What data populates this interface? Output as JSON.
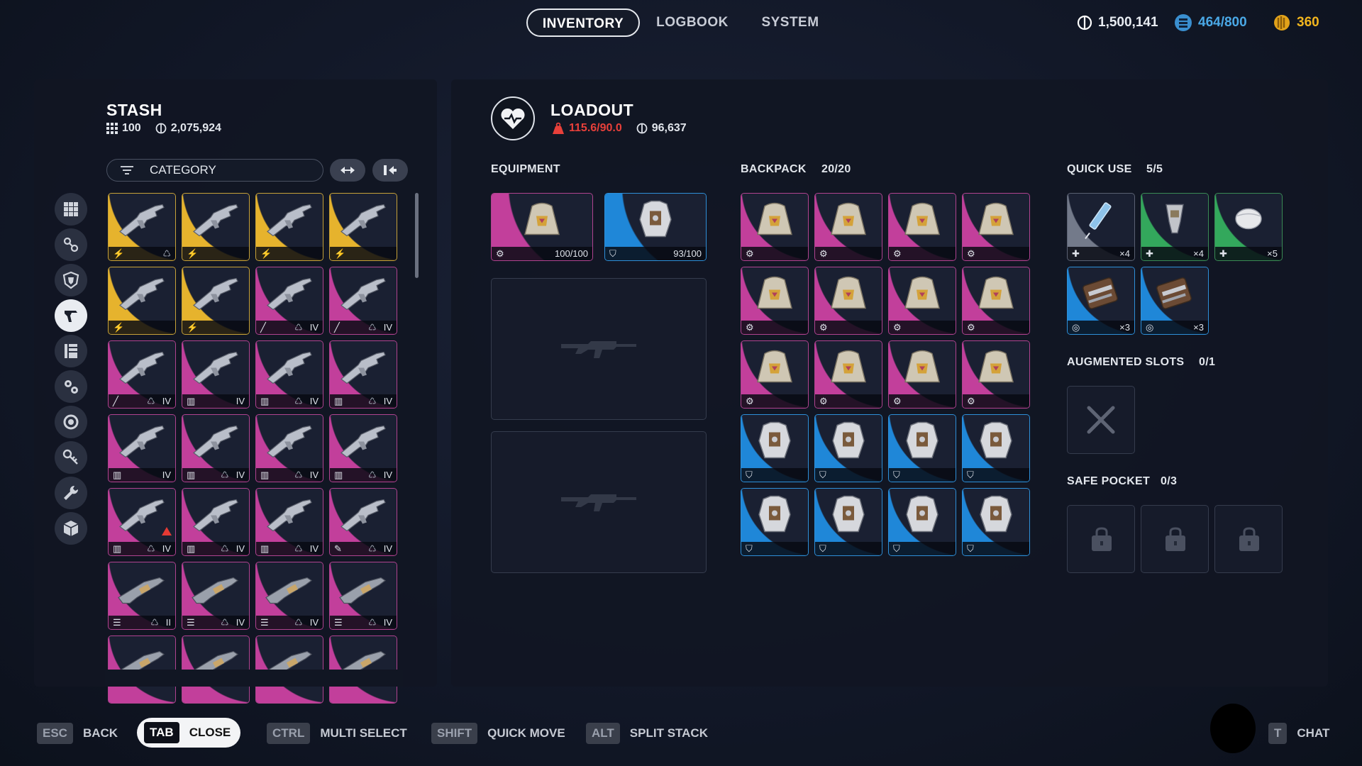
{
  "nav": {
    "tabs": [
      "INVENTORY",
      "LOGBOOK",
      "SYSTEM"
    ],
    "active": 0
  },
  "currency": {
    "coins": "1,500,141",
    "capacity": "464/800",
    "tokens": "360",
    "coins_color": "#ffffff",
    "capacity_color": "#4aa8e6",
    "tokens_color": "#f2b51e"
  },
  "stash": {
    "title": "STASH",
    "count": "100",
    "value": "2,075,924",
    "filter_placeholder": "CATEGORY",
    "categories": [
      "grid-icon",
      "attachments-icon",
      "shield-icon",
      "weapon-icon",
      "book-icon",
      "gears-icon",
      "ring-icon",
      "key-icon",
      "wrench-icon",
      "cube-icon"
    ],
    "active_category": 3,
    "rows": [
      [
        {
          "r": "gold",
          "l": "⚡",
          "m": "♺",
          "t": ""
        },
        {
          "r": "gold",
          "l": "⚡",
          "m": "",
          "t": ""
        },
        {
          "r": "gold",
          "l": "⚡",
          "m": "",
          "t": ""
        },
        {
          "r": "gold",
          "l": "⚡",
          "m": "",
          "t": ""
        }
      ],
      [
        {
          "r": "gold",
          "l": "⚡",
          "m": "",
          "t": ""
        },
        {
          "r": "gold",
          "l": "⚡",
          "m": "",
          "t": ""
        },
        {
          "r": "pink",
          "l": "╱",
          "m": "♺",
          "t": "IV"
        },
        {
          "r": "pink",
          "l": "╱",
          "m": "♺",
          "t": "IV"
        }
      ],
      [
        {
          "r": "pink",
          "l": "╱",
          "m": "♺",
          "t": "IV"
        },
        {
          "r": "pink",
          "l": "▥",
          "m": "",
          "t": "IV"
        },
        {
          "r": "pink",
          "l": "▥",
          "m": "♺",
          "t": "IV"
        },
        {
          "r": "pink",
          "l": "▥",
          "m": "♺",
          "t": "IV"
        }
      ],
      [
        {
          "r": "pink",
          "l": "▥",
          "m": "",
          "t": "IV"
        },
        {
          "r": "pink",
          "l": "▥",
          "m": "♺",
          "t": "IV"
        },
        {
          "r": "pink",
          "l": "▥",
          "m": "♺",
          "t": "IV"
        },
        {
          "r": "pink",
          "l": "▥",
          "m": "♺",
          "t": "IV"
        }
      ],
      [
        {
          "r": "pink",
          "l": "▥",
          "m": "♺",
          "t": "IV",
          "warn": true
        },
        {
          "r": "pink",
          "l": "▥",
          "m": "♺",
          "t": "IV"
        },
        {
          "r": "pink",
          "l": "▥",
          "m": "♺",
          "t": "IV"
        },
        {
          "r": "pink",
          "l": "✎",
          "m": "♺",
          "t": "IV"
        }
      ],
      [
        {
          "r": "pink",
          "l": "☰",
          "m": "♺",
          "t": "II"
        },
        {
          "r": "pink",
          "l": "☰",
          "m": "♺",
          "t": "IV"
        },
        {
          "r": "pink",
          "l": "☰",
          "m": "♺",
          "t": "IV"
        },
        {
          "r": "pink",
          "l": "☰",
          "m": "♺",
          "t": "IV"
        }
      ],
      [
        {
          "r": "pink",
          "l": "",
          "m": "",
          "t": ""
        },
        {
          "r": "pink",
          "l": "",
          "m": "",
          "t": ""
        },
        {
          "r": "pink",
          "l": "",
          "m": "",
          "t": ""
        },
        {
          "r": "pink",
          "l": "",
          "m": "",
          "t": ""
        }
      ]
    ]
  },
  "loadout": {
    "title": "LOADOUT",
    "weight": "115.6/90.0",
    "weight_color": "#e8403a",
    "value": "96,637",
    "equipment_label": "EQUIPMENT",
    "equipment": [
      {
        "r": "pink",
        "icon": "backpack",
        "l": "⚙",
        "t": "100/100"
      },
      {
        "r": "blue",
        "icon": "armor",
        "l": "⛉",
        "t": "93/100"
      }
    ],
    "backpack_label": "BACKPACK",
    "backpack_count": "20/20",
    "quick_label": "QUICK USE",
    "quick_count": "5/5",
    "quick": [
      {
        "r": "gray",
        "icon": "syringe",
        "l": "✚",
        "t": "×4"
      },
      {
        "r": "green",
        "icon": "injector",
        "l": "✚",
        "t": "×4"
      },
      {
        "r": "green",
        "icon": "bandage",
        "l": "✚",
        "t": "×5"
      },
      {
        "r": "blue",
        "icon": "grenade",
        "l": "◎",
        "t": "×3"
      },
      {
        "r": "blue",
        "icon": "grenade",
        "l": "◎",
        "t": "×3"
      }
    ],
    "augmented_label": "AUGMENTED SLOTS",
    "augmented_count": "0/1",
    "safe_label": "SAFE POCKET",
    "safe_count": "0/3"
  },
  "footer": [
    {
      "key": "ESC",
      "label": "BACK"
    },
    {
      "key": "TAB",
      "label": "CLOSE"
    },
    {
      "key": "CTRL",
      "label": "MULTI SELECT"
    },
    {
      "key": "SHIFT",
      "label": "QUICK MOVE"
    },
    {
      "key": "ALT",
      "label": "SPLIT STACK"
    },
    {
      "key": "T",
      "label": "CHAT"
    }
  ]
}
